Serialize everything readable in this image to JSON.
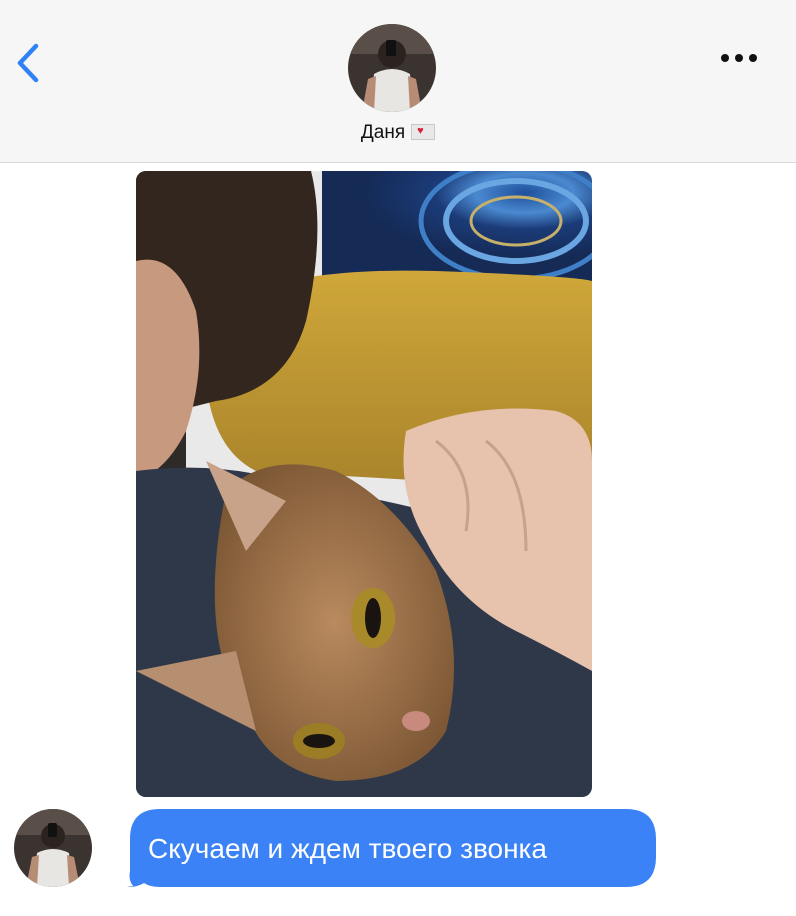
{
  "header": {
    "contact_name": "Даня",
    "contact_emoji": "love-letter-icon",
    "back_icon": "chevron-left-icon",
    "menu_icon": "ellipsis-icon",
    "accent_color": "#2f82f5"
  },
  "conversation": {
    "photo_description_icon": "cat-photo",
    "message_text": "Скучаем и ждем твоего звонка",
    "bubble_color": "#3a82f6"
  }
}
